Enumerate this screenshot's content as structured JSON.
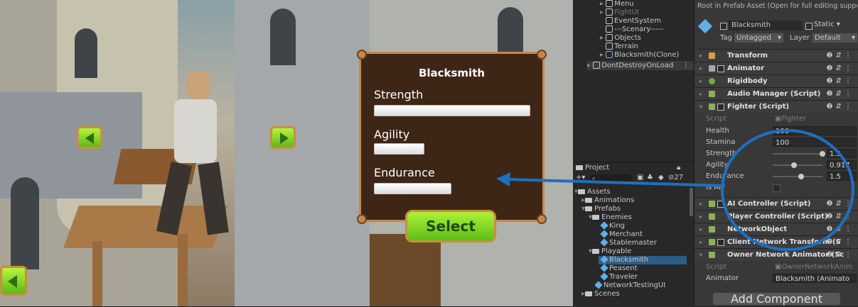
{
  "game": {
    "panel_title": "Blacksmith",
    "stats": [
      {
        "label": "Strength",
        "value": 1.0
      },
      {
        "label": "Agility",
        "value": 0.315
      },
      {
        "label": "Endurance",
        "value": 0.49
      }
    ],
    "select_label": "Select"
  },
  "hierarchy": {
    "items": [
      {
        "label": "Menu"
      },
      {
        "label": "FightUI"
      },
      {
        "label": "EventSystem"
      },
      {
        "label": "---Scenary-----"
      },
      {
        "label": "Objects"
      },
      {
        "label": "Terrain"
      },
      {
        "label": "Blacksmith(Clone)"
      },
      {
        "label": "DontDestroyOnLoad"
      }
    ]
  },
  "project": {
    "tab_label": "Project",
    "hidden_count": "27",
    "items": [
      {
        "label": "Assets"
      },
      {
        "label": "Animations"
      },
      {
        "label": "Prefabs"
      },
      {
        "label": "Enemies"
      },
      {
        "label": "King"
      },
      {
        "label": "Merchant"
      },
      {
        "label": "Stablemaster"
      },
      {
        "label": "Playable"
      },
      {
        "label": "Blacksmith"
      },
      {
        "label": "Peasent"
      },
      {
        "label": "Traveler"
      },
      {
        "label": "NetworkTestingUI"
      },
      {
        "label": "Scenes"
      }
    ]
  },
  "inspector": {
    "header_note": "Root in Prefab Asset (Open for full editing support)",
    "object_name": "Blacksmith",
    "static_label": "Static",
    "tag_label": "Tag",
    "tag_value": "Untagged",
    "layer_label": "Layer",
    "layer_value": "Default",
    "components": [
      {
        "label": "Transform"
      },
      {
        "label": "Animator"
      },
      {
        "label": "Rigidbody"
      },
      {
        "label": "Audio Manager (Script)"
      },
      {
        "label": "Fighter (Script)"
      },
      {
        "label": "AI Controller (Script)"
      },
      {
        "label": "Player Controller (Script)"
      },
      {
        "label": "NetworkObject"
      },
      {
        "label": "Client Network Transform (S"
      },
      {
        "label": "Owner Network Animator (Sc"
      }
    ],
    "fighter": {
      "script_label": "Script",
      "script_value": "Fighter",
      "health_label": "Health",
      "health_value": "100",
      "stamina_label": "Stamina",
      "stamina_value": "100",
      "strength_label": "Strength",
      "strength_value": "1.5",
      "agility_label": "Agility",
      "agility_value": "0.917",
      "endurance_label": "Endurance",
      "endurance_value": "1.5",
      "isai_label": "Is AI"
    },
    "owner_anim": {
      "script_label": "Script",
      "script_value": "OwnerNetworkAnim",
      "animator_label": "Animator",
      "animator_value": "Blacksmith (Animato"
    },
    "add_component_label": "Add Component"
  },
  "colors": {
    "annotation_blue": "#1f6fbf",
    "panel_bg": "#3d2616",
    "panel_border": "#c7874b",
    "button_green": "#7ad424"
  }
}
